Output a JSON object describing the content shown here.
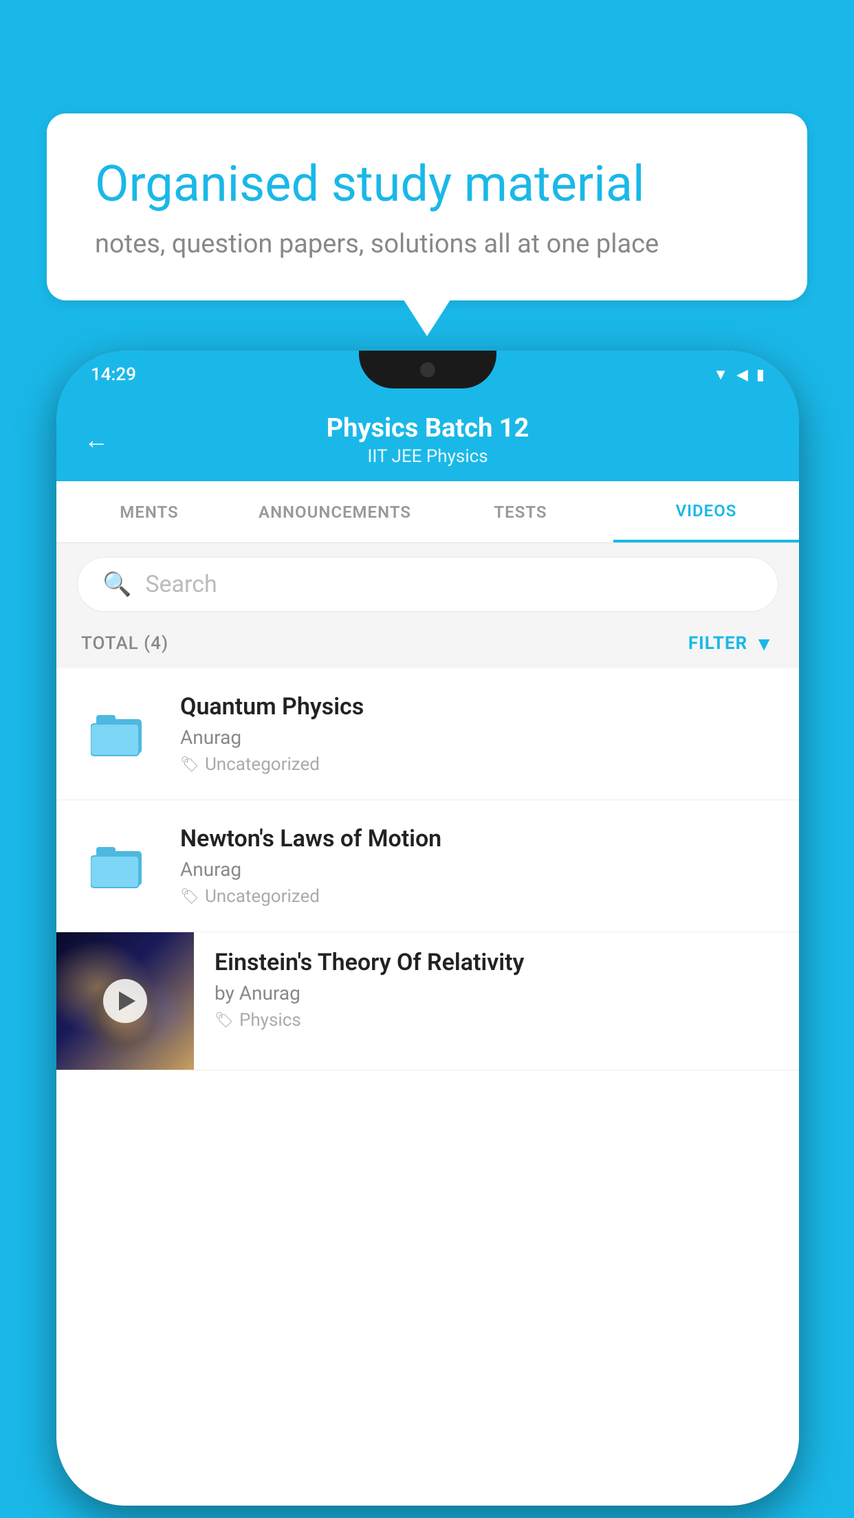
{
  "background_color": "#1ab8e8",
  "speech_bubble": {
    "title": "Organised study material",
    "subtitle": "notes, question papers, solutions all at one place"
  },
  "phone": {
    "status_bar": {
      "time": "14:29"
    },
    "header": {
      "back_label": "←",
      "title": "Physics Batch 12",
      "subtitle_tags": "IIT JEE   Physics"
    },
    "tabs": [
      {
        "label": "MENTS",
        "active": false
      },
      {
        "label": "ANNOUNCEMENTS",
        "active": false
      },
      {
        "label": "TESTS",
        "active": false
      },
      {
        "label": "VIDEOS",
        "active": true
      }
    ],
    "search": {
      "placeholder": "Search"
    },
    "total_bar": {
      "total_label": "TOTAL (4)",
      "filter_label": "FILTER"
    },
    "videos": [
      {
        "title": "Quantum Physics",
        "author": "Anurag",
        "tag": "Uncategorized",
        "has_thumbnail": false
      },
      {
        "title": "Newton's Laws of Motion",
        "author": "Anurag",
        "tag": "Uncategorized",
        "has_thumbnail": false
      },
      {
        "title": "Einstein's Theory Of Relativity",
        "author": "by Anurag",
        "tag": "Physics",
        "has_thumbnail": true
      }
    ]
  }
}
